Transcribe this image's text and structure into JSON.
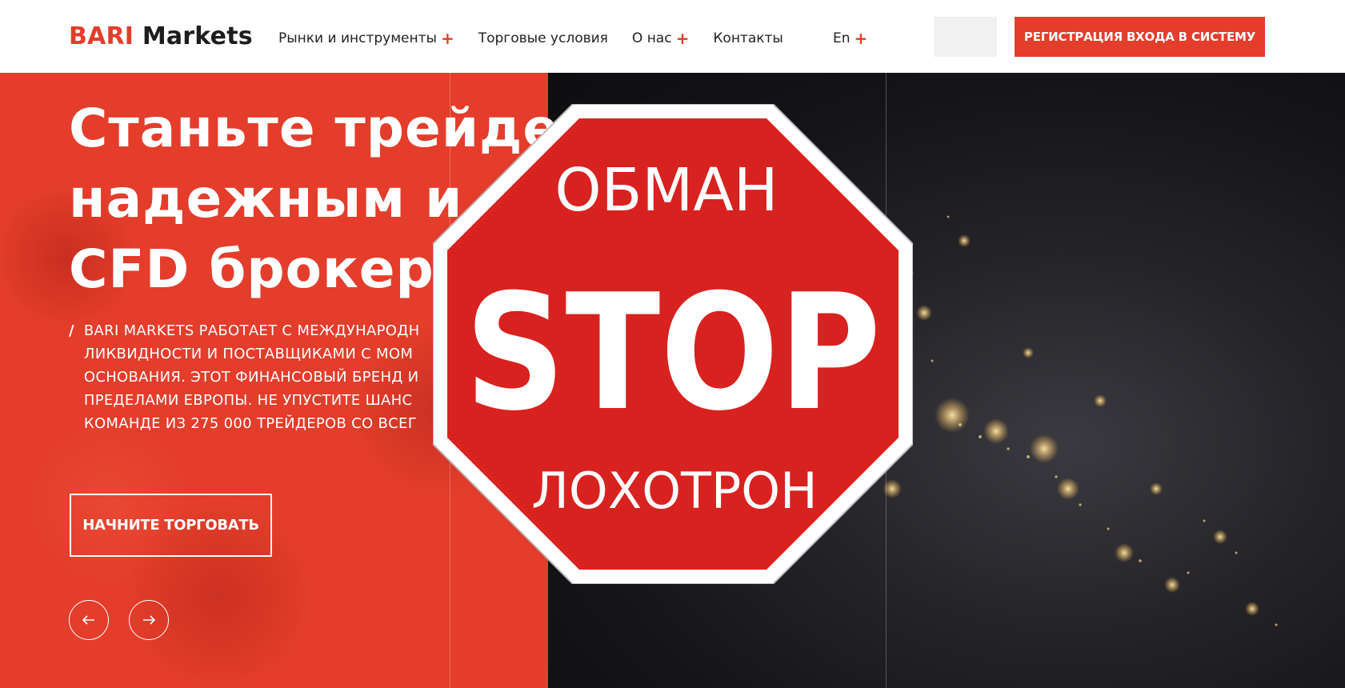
{
  "header": {
    "logo_brand": "BARI",
    "logo_name": "Markets",
    "nav": [
      {
        "label": "Рынки и инструменты",
        "has_plus": true
      },
      {
        "label": "Торговые условия",
        "has_plus": false
      },
      {
        "label": "О нас",
        "has_plus": true
      },
      {
        "label": "Контакты",
        "has_plus": false
      }
    ],
    "plus_symbol": "+",
    "lang": "En",
    "register_button": "РЕГИСТРАЦИЯ ВХОДА В СИСТЕМУ"
  },
  "hero": {
    "title_lines": [
      "Станьте трейдер",
      "надежным и а",
      "CFD брокеро"
    ],
    "desc_slash": "/",
    "desc_lines": [
      "BARI MARKETS РАБОТАЕТ С МЕЖДУНАРОДН",
      "ЛИКВИДНОСТИ И ПОСТАВЩИКАМИ С МОМ",
      "ОСНОВАНИЯ. ЭТОТ ФИНАНСОВЫЙ БРЕНД И",
      "ПРЕДЕЛАМИ ЕВРОПЫ. НЕ УПУСТИТЕ ШАНС",
      "КОМАНДЕ ИЗ 275 000 ТРЕЙДЕРОВ СО ВСЕГ"
    ],
    "cta_label": "НАЧНИТЕ ТОРГОВАТЬ",
    "left_color": "#e43d2b"
  },
  "stop_sign": {
    "top_text": "ОБМАН",
    "main_text": "STOP",
    "bottom_text": "ЛОХОТРОН",
    "color": "#d8221f"
  },
  "icons": {
    "prev": "arrow-left-icon",
    "next": "arrow-right-icon"
  }
}
